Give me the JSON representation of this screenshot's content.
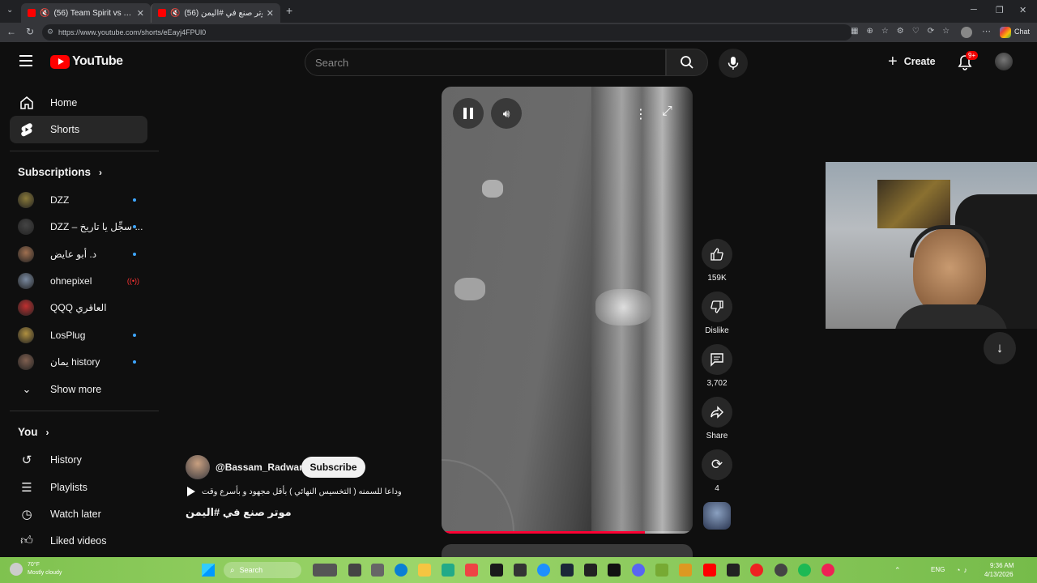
{
  "browser": {
    "tabs": [
      {
        "title": "(56) Team Spirit vs Team Liqu..."
      },
      {
        "title": "(56) موتر صنع في #اليمن - be"
      }
    ],
    "url": "https://www.youtube.com/shorts/eEayj4FPUl0",
    "chat_label": "Chat"
  },
  "header": {
    "logo_text": "YouTube",
    "search_placeholder": "Search",
    "create_label": "Create",
    "notif_badge": "9+"
  },
  "sidebar": {
    "home": "Home",
    "shorts": "Shorts",
    "subscriptions_title": "Subscriptions",
    "subscriptions": [
      {
        "name": "DZZ",
        "color": "#8a7a3a",
        "live": false
      },
      {
        "name": "DZZ – سجِّل يا تاريخ ...",
        "color": "#444444",
        "live": false
      },
      {
        "name": "د. أبو عايض",
        "color": "#a07050",
        "live": false
      },
      {
        "name": "ohnepixel",
        "color": "#7a8aa0",
        "live": true
      },
      {
        "name": "QQQ العاقري",
        "color": "#c03030",
        "live": false
      },
      {
        "name": "LosPlug",
        "color": "#b09040",
        "live": false
      },
      {
        "name": "يمان history",
        "color": "#806050",
        "live": false
      }
    ],
    "show_more": "Show more",
    "you_title": "You",
    "you_items": [
      {
        "label": "History",
        "icon": "history-icon"
      },
      {
        "label": "Playlists",
        "icon": "playlists-icon"
      },
      {
        "label": "Watch later",
        "icon": "watch-later-icon"
      },
      {
        "label": "Liked videos",
        "icon": "liked-videos-icon"
      }
    ]
  },
  "short": {
    "channel": "@Bassam_Radwan",
    "subscribe_label": "Subscribe",
    "playlist_text": "وداعا للسمنه ( التخسيس النهائي ) بأقل مجهود و بأسرع وقت",
    "title": "موتر صنع في #اليمن",
    "progress": 0.81,
    "likes": "159K",
    "dislike_label": "Dislike",
    "comments": "3,702",
    "share_label": "Share",
    "remix_count": "4"
  },
  "taskbar": {
    "weather_temp": "70°F",
    "weather_text": "Mostly cloudy",
    "search_label": "Search",
    "lang": "ENG",
    "time": "9:36 AM",
    "date": "4/13/2026"
  }
}
